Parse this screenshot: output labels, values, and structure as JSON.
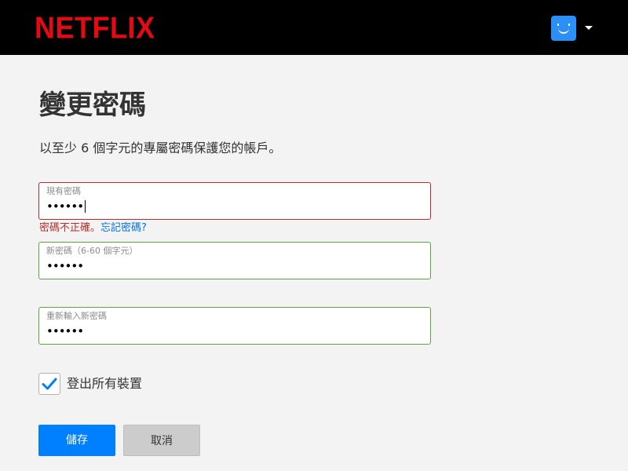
{
  "header": {
    "logo_text": "NETFLIX",
    "brand_color": "#e50914",
    "profile_icon": "profile-avatar-icon",
    "profile_color": "#2b8ff5",
    "menu_icon": "caret-down-icon"
  },
  "page": {
    "title": "變更密碼",
    "subtitle": "以至少 6 個字元的專屬密碼保護您的帳戶。"
  },
  "form": {
    "current_password": {
      "label": "現有密碼",
      "value": "••••••",
      "error_text": "密碼不正確。",
      "forgot_link": "忘記密碼?"
    },
    "new_password": {
      "label": "新密碼（6-60 個字元）",
      "value": "••••••"
    },
    "confirm_password": {
      "label": "重新輸入新密碼",
      "value": "••••••"
    },
    "signout_all": {
      "label": "登出所有裝置",
      "checked": true
    }
  },
  "buttons": {
    "save": "儲存",
    "cancel": "取消"
  },
  "colors": {
    "error": "#b92d2b",
    "valid": "#5fa53f",
    "link": "#0071eb",
    "primary_button": "#0080ff"
  }
}
